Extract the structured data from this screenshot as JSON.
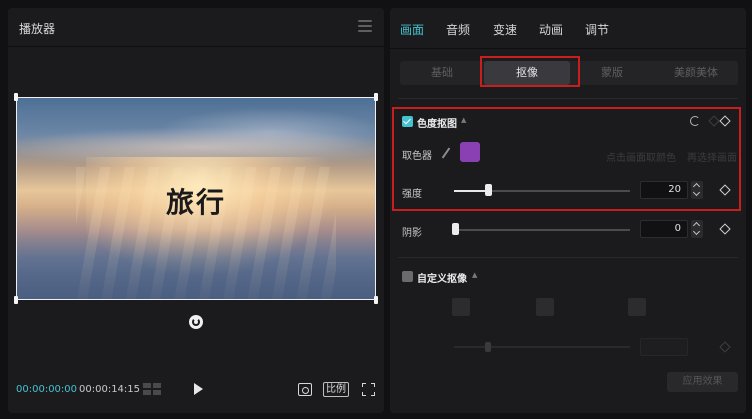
{
  "player": {
    "title": "播放器",
    "video_text": "旅行",
    "time_current": "00:00:00:00",
    "time_total": "00:00:14:15",
    "ratio_label": "比例"
  },
  "panel": {
    "tabs": [
      {
        "label": "画面",
        "active": true
      },
      {
        "label": "音频",
        "active": false
      },
      {
        "label": "变速",
        "active": false
      },
      {
        "label": "动画",
        "active": false
      },
      {
        "label": "调节",
        "active": false
      }
    ],
    "subtabs": [
      {
        "label": "基础",
        "active": false
      },
      {
        "label": "抠像",
        "active": true
      },
      {
        "label": "蒙版",
        "active": false
      },
      {
        "label": "美颜美体",
        "active": false
      }
    ],
    "chroma_key": {
      "title": "色度抠图",
      "checked": true,
      "picker_label": "取色器",
      "picked_color": "#8a3fb3",
      "picker_hint_1": "点击画面取颜色",
      "picker_hint_2": "再选择画面",
      "strength_label": "强度",
      "strength_value": "20",
      "strength_fraction": 0.2,
      "shadow_label": "阴影",
      "shadow_value": "0",
      "shadow_fraction": 0.0
    },
    "custom_matting": {
      "title": "自定义抠像",
      "checked": false,
      "apply_label": "应用效果"
    }
  },
  "colors": {
    "accent": "#46c1d0",
    "highlight_border": "#c81e1e",
    "panel_bg": "#1b1b1d"
  }
}
